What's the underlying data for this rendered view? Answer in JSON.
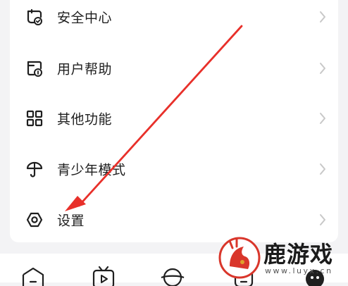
{
  "menu": {
    "items": [
      {
        "label": "安全中心",
        "icon": "shield-check-icon"
      },
      {
        "label": "用户帮助",
        "icon": "help-doc-icon"
      },
      {
        "label": "其他功能",
        "icon": "grid-icon"
      },
      {
        "label": "青少年模式",
        "icon": "umbrella-icon"
      },
      {
        "label": "设置",
        "icon": "hexagon-settings-icon"
      }
    ]
  },
  "bottom_nav": {
    "items": [
      {
        "icon": "home-icon"
      },
      {
        "icon": "tv-icon"
      },
      {
        "icon": "planet-icon"
      },
      {
        "icon": "message-icon"
      },
      {
        "icon": "profile-icon"
      }
    ]
  },
  "annotation": {
    "color": "#e8302a",
    "type": "arrow pointing to 设置"
  },
  "watermark": {
    "title": "鹿游戏",
    "url": "www.luyx.cn"
  },
  "colors": {
    "background": "#f3f3f5",
    "card": "#ffffff",
    "text": "#1f1f1f",
    "chevron": "#c8c8c8",
    "arrow": "#e8302a"
  }
}
